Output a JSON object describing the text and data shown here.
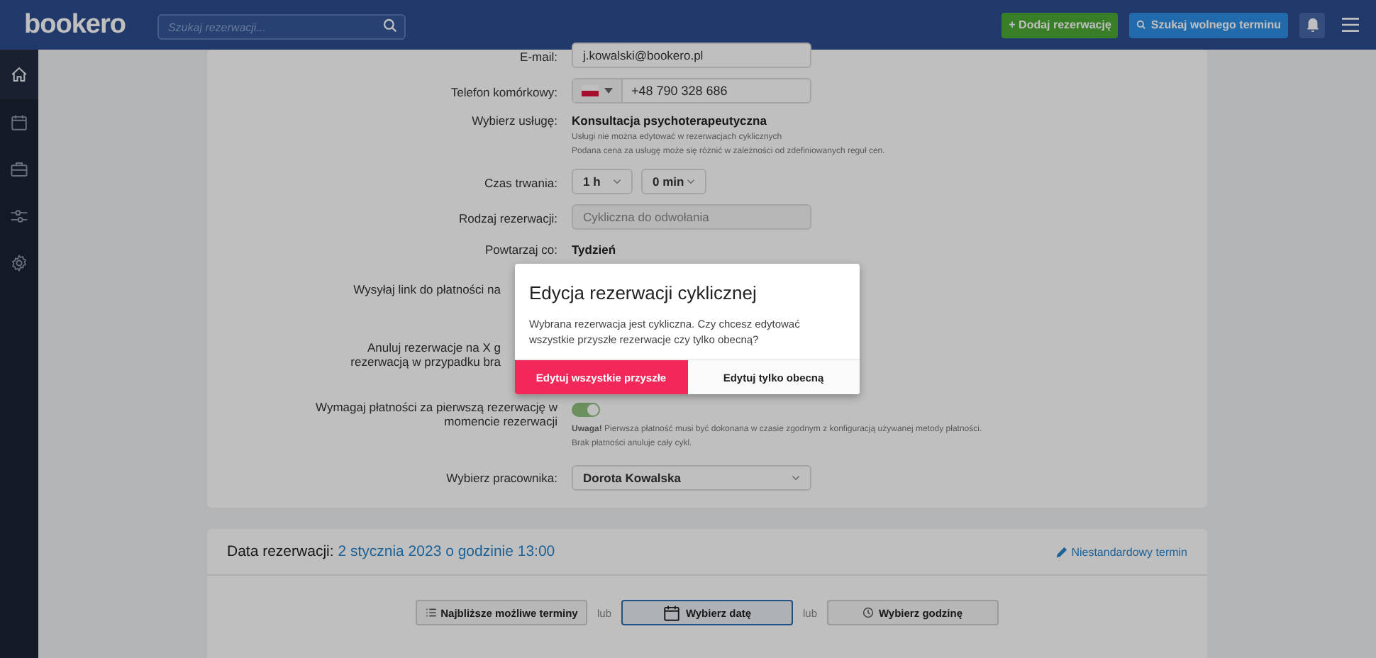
{
  "header": {
    "logo": "bookero",
    "search": {
      "placeholder": "Szukaj rezerwacji..."
    },
    "add_button": "+ Dodaj rezerwację",
    "find_button": "Szukaj wolnego terminu"
  },
  "sidebar": {
    "items": [
      {
        "selected": true
      },
      {
        "selected": false
      },
      {
        "selected": false
      },
      {
        "selected": false
      },
      {
        "selected": false
      }
    ]
  },
  "form": {
    "rows": [
      {
        "kind": "input",
        "label": "E-mail:",
        "value": "j.kowalski@bookero.pl"
      },
      {
        "kind": "phone",
        "label": "Telefon komórkowy:",
        "value": "+48 790 328 686"
      },
      {
        "kind": "service",
        "label": "Wybierz usługę:",
        "value": "Konsultacja psychoterapeutyczna",
        "notes": [
          "Usługi nie można edytować w rezerwacjach cyklicznych",
          "Podana cena za usługę może się różnić w zależności od zdefiniowanych reguł cen."
        ]
      },
      {
        "kind": "duration",
        "label": "Czas trwania:",
        "hours": "1 h",
        "minutes": "0 min"
      },
      {
        "kind": "disabled",
        "label": "Rodzaj rezerwacji:",
        "value": "Cykliczna do odwołania"
      },
      {
        "kind": "text",
        "label": "Powtarzaj co:",
        "value": "Tydzień"
      },
      {
        "kind": "hidden",
        "label": "Wysyłaj link do płatności na"
      },
      {
        "kind": "hidden",
        "label": "Anuluj rezerwacje na X g\nrezerwacją w przypadku bra"
      },
      {
        "kind": "toggle",
        "label": "Wymagaj płatności za pierwszą rezerwację w\nmomencie rezerwacji",
        "on": true,
        "note": "**Uwaga!** Pierwsza płatność musi być dokonana w czasie zgodnym z konfiguracją używanej metody płatności.\nBrak płatności anuluje cały cykl."
      },
      {
        "kind": "select",
        "label": "Wybierz pracownika:",
        "value": "Dorota Kowalska"
      }
    ]
  },
  "date_card": {
    "label": "Data rezerwacji:",
    "value": "2 stycznia 2023 o godzinie 13:00",
    "custom_link": "Niestandardowy termin",
    "options": [
      {
        "label": "Najbliższe możliwe terminy",
        "selected": false
      },
      {
        "label": "Wybierz datę",
        "selected": true
      },
      {
        "label": "Wybierz godzinę",
        "selected": false
      }
    ],
    "separators": [
      "lub",
      "lub"
    ]
  },
  "dialog": {
    "title": "Edycja rezerwacji cyklicznej",
    "message": "Wybrana rezerwacja jest cykliczna. Czy chcesz edytować wszystkie przyszłe rezerwacje czy tylko obecną?",
    "buttons": [
      {
        "label": "Edytuj wszystkie przyszłe",
        "primary": true
      },
      {
        "label": "Edytuj tylko obecną",
        "primary": false
      }
    ]
  }
}
